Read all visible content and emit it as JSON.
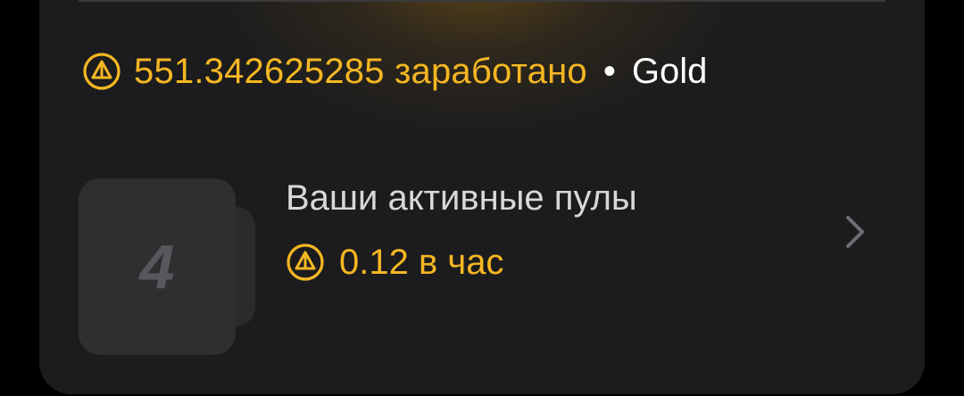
{
  "summary": {
    "earned_amount": "551.342625285",
    "earned_suffix": "заработано",
    "separator": "•",
    "tier": "Gold"
  },
  "pools": {
    "count": "4",
    "title": "Ваши активные пулы",
    "rate_amount": "0.12",
    "rate_suffix": "в час"
  },
  "icons": {
    "coin": "coin-icon",
    "chevron": "chevron-right-icon"
  },
  "colors": {
    "accent": "#f5b722",
    "card_background": "#1c1c1e",
    "page_background": "#000000",
    "text_primary": "#ffffff",
    "text_secondary": "#d8d8da",
    "pool_count": "#58585c"
  }
}
